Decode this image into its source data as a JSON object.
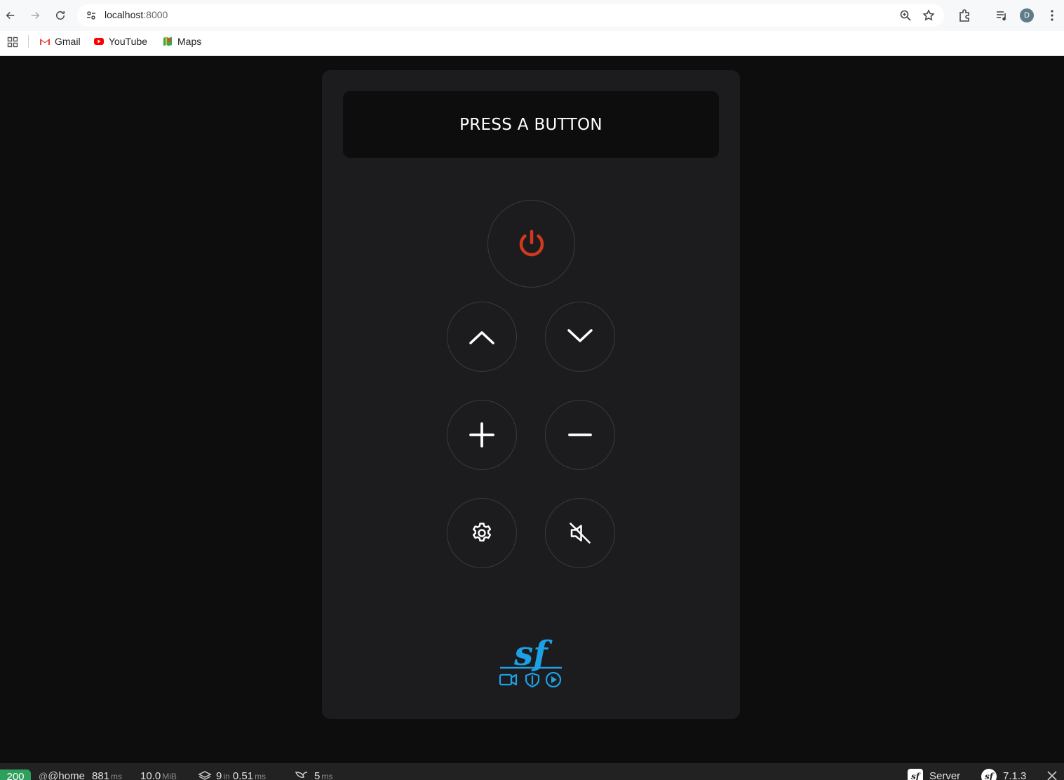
{
  "browser": {
    "url_host": "localhost",
    "url_port": ":8000",
    "profile_initial": "D",
    "bookmarks": [
      {
        "label": "Gmail"
      },
      {
        "label": "YouTube"
      },
      {
        "label": "Maps"
      }
    ]
  },
  "remote": {
    "display_text": "PRESS A BUTTON",
    "buttons": [
      {
        "name": "power",
        "icon": "power-icon",
        "color": "#d0391b"
      },
      {
        "name": "channel-up",
        "icon": "chevron-up-icon"
      },
      {
        "name": "channel-down",
        "icon": "chevron-down-icon"
      },
      {
        "name": "volume-up",
        "icon": "plus-icon"
      },
      {
        "name": "volume-down",
        "icon": "minus-icon"
      },
      {
        "name": "settings",
        "icon": "gear-icon"
      },
      {
        "name": "mute",
        "icon": "mute-icon"
      }
    ],
    "logo": "symfony-ux-logo",
    "accent": "#1da1e6"
  },
  "profiler": {
    "status_code": "200",
    "route": "@home",
    "time_value": "881",
    "time_unit": "ms",
    "memory_value": "10.0",
    "memory_unit": "MiB",
    "twig_count": "9",
    "twig_in": "in",
    "twig_time": "0.51",
    "twig_unit": "ms",
    "render_value": "5",
    "render_unit": "ms",
    "server_label": "Server",
    "version": "7.1.3"
  }
}
